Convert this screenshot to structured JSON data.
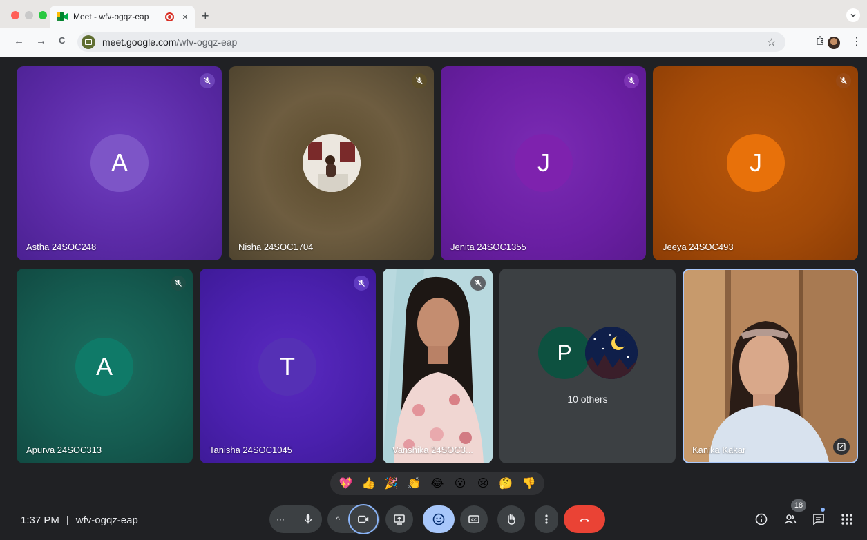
{
  "browser": {
    "tab_title": "Meet - wfv-ogqz-eap",
    "tab_close": "×",
    "new_tab": "+",
    "url_host": "meet.google.com",
    "url_path": "/wfv-ogqz-eap",
    "back_glyph": "←",
    "forward_glyph": "→",
    "reload_glyph": "C",
    "star_glyph": "☆",
    "kebab_glyph": "⋮"
  },
  "tiles": {
    "astha": {
      "name": "Astha 24SOC248",
      "initial": "A"
    },
    "nisha": {
      "name": "Nisha 24SOC1704"
    },
    "jenita": {
      "name": "Jenita 24SOC1355",
      "initial": "J"
    },
    "jeeya": {
      "name": "Jeeya 24SOC493",
      "initial": "J"
    },
    "apurva": {
      "name": "Apurva 24SOC313",
      "initial": "A"
    },
    "tanisha": {
      "name": "Tanisha 24SOC1045",
      "initial": "T"
    },
    "vanshika": {
      "name": "Vanshika 24SOC3..."
    },
    "others": {
      "initial": "P",
      "label": "10 others"
    },
    "kanika": {
      "name": "Kanika Kakar"
    }
  },
  "reactions": [
    "💖",
    "👍",
    "🎉",
    "👏",
    "😂",
    "😮",
    "😢",
    "🤔",
    "👎"
  ],
  "meeting": {
    "time": "1:37 PM",
    "separator": "|",
    "code": "wfv-ogqz-eap",
    "more_glyph": "···",
    "chevron_glyph": "^"
  },
  "people_count": "18",
  "colors": {
    "accent_blue": "#8ab4f8",
    "hangup_red": "#ea4335",
    "control_gray": "#3c4043"
  }
}
